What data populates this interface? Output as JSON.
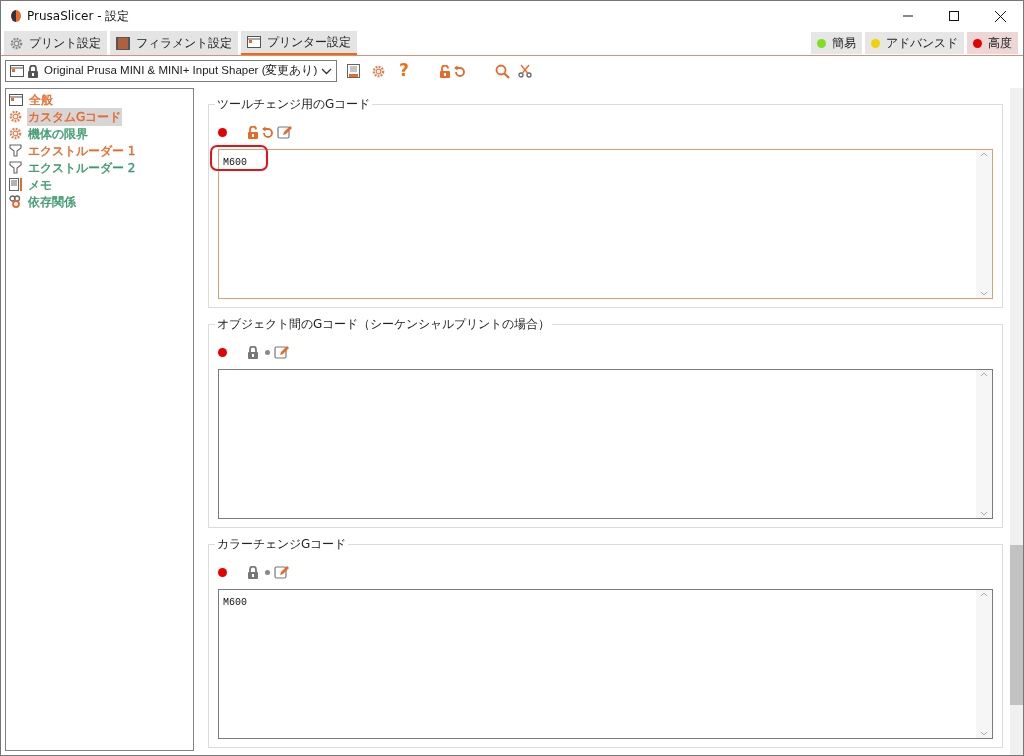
{
  "window": {
    "title": "PrusaSlicer - 設定"
  },
  "tabs": [
    {
      "label": "プリント設定",
      "kind": "print",
      "selected": false
    },
    {
      "label": "フィラメント設定",
      "kind": "filament",
      "selected": false
    },
    {
      "label": "プリンター設定",
      "kind": "printer",
      "selected": true
    }
  ],
  "modes": [
    {
      "label": "簡易",
      "color": "#7ee021",
      "selected": false
    },
    {
      "label": "アドバンスド",
      "color": "#f5d000",
      "selected": false
    },
    {
      "label": "高度",
      "color": "#e80000",
      "selected": true
    }
  ],
  "preset": {
    "value": "Original Prusa MINI & MINI+ Input Shaper (変更あり)"
  },
  "toolbar": {
    "help": "?"
  },
  "sidebar": {
    "items": [
      {
        "label": "全般",
        "kind": "page",
        "color": "#e8692a",
        "selected": false
      },
      {
        "label": "カスタムGコード",
        "kind": "gear",
        "color": "#e8692a",
        "selected": true
      },
      {
        "label": "機体の限界",
        "kind": "gear",
        "color": "#3c9a6e",
        "selected": false
      },
      {
        "label": "エクストルーダー 1",
        "kind": "funnel",
        "color": "#e8692a",
        "selected": false
      },
      {
        "label": "エクストルーダー 2",
        "kind": "funnel",
        "color": "#3c9a6e",
        "selected": false
      },
      {
        "label": "メモ",
        "kind": "note",
        "color": "#3c9a6e",
        "selected": false
      },
      {
        "label": "依存関係",
        "kind": "link",
        "color": "#3c9a6e",
        "selected": false
      }
    ]
  },
  "sections": [
    {
      "title": "ツールチェンジ用のGコード",
      "modified": true,
      "focused": true,
      "circled": true,
      "value": "M600"
    },
    {
      "title": "オブジェクト間のGコード（シーケンシャルプリントの場合）",
      "modified": false,
      "focused": false,
      "circled": false
    },
    {
      "title": "カラーチェンジGコード",
      "modified": false,
      "focused": false,
      "circled": false,
      "value": "M600"
    }
  ]
}
